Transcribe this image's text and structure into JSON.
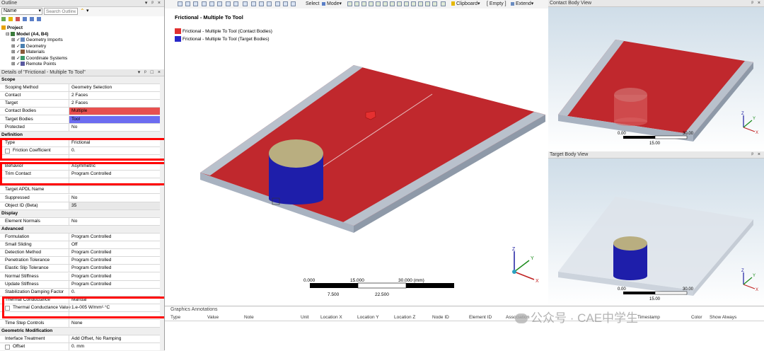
{
  "outline": {
    "title": "Outline",
    "filter_combo": "Name",
    "search_placeholder": "Search Outline",
    "tree": {
      "project": "Project",
      "model": "Model (A4, B4)",
      "items": [
        "Geometry Imports",
        "Geometry",
        "Materials",
        "Coordinate Systems",
        "Remote Points"
      ]
    }
  },
  "details": {
    "title": "Details of \"Frictional - Multiple To Tool\"",
    "rows": [
      {
        "type": "section",
        "label": "Scope"
      },
      {
        "label": "Scoping Method",
        "value": "Geometry Selection"
      },
      {
        "label": "Contact",
        "value": "2 Faces"
      },
      {
        "label": "Target",
        "value": "2 Faces"
      },
      {
        "label": "Contact Bodies",
        "value": "Multiple"
      },
      {
        "label": "Target Bodies",
        "value": "Tool"
      },
      {
        "label": "Protected",
        "value": "No"
      },
      {
        "type": "section",
        "label": "Definition"
      },
      {
        "label": "Type",
        "value": "Frictional"
      },
      {
        "label": "Friction Coefficient",
        "value": "0."
      },
      {
        "label": "",
        "value": ""
      },
      {
        "label": "Behavior",
        "value": "Asymmetric"
      },
      {
        "label": "Trim Contact",
        "value": "Program Controlled"
      },
      {
        "label": "",
        "value": ""
      },
      {
        "label": "Target APDL Name",
        "value": ""
      },
      {
        "label": "Suppressed",
        "value": "No"
      },
      {
        "label": "Object ID (Beta)",
        "value": "35"
      },
      {
        "type": "section",
        "label": "Display"
      },
      {
        "label": "Element Normals",
        "value": "No"
      },
      {
        "type": "section",
        "label": "Advanced"
      },
      {
        "label": "Formulation",
        "value": "Program Controlled"
      },
      {
        "label": "Small Sliding",
        "value": "Off"
      },
      {
        "label": "Detection Method",
        "value": "Program Controlled"
      },
      {
        "label": "Penetration Tolerance",
        "value": "Program Controlled"
      },
      {
        "label": "Elastic Slip Tolerance",
        "value": "Program Controlled"
      },
      {
        "label": "Normal Stiffness",
        "value": "Program Controlled"
      },
      {
        "label": "Update Stiffness",
        "value": "Program Controlled"
      },
      {
        "label": "Stabilization Damping Factor",
        "value": "0."
      },
      {
        "label": "Thermal Conductance",
        "value": "Manual"
      },
      {
        "label": "Thermal Conductance Value",
        "value": "1.e-005 W/mm²·°C"
      },
      {
        "label": "",
        "value": ""
      },
      {
        "label": "Time Step Controls",
        "value": "None"
      },
      {
        "type": "section",
        "label": "Geometric Modification"
      },
      {
        "label": "Interface Treatment",
        "value": "Add Offset, No Ramping"
      },
      {
        "label": "Offset",
        "value": "0. mm"
      }
    ]
  },
  "toolbar": {
    "select": "Select",
    "mode": "Mode",
    "clipboard": "Clipboard",
    "empty": "[ Empty ]",
    "extend": "Extend"
  },
  "graphics": {
    "title": "Frictional - Multiple To Tool",
    "legend": [
      {
        "label": "Frictional - Multiple To Tool (Contact Bodies)",
        "color": "#e03030"
      },
      {
        "label": "Frictional - Multiple To Tool (Target Bodies)",
        "color": "#2828c8"
      }
    ],
    "scale": {
      "top_labels": [
        "0.000",
        "15.000",
        "30.000 (mm)"
      ],
      "bottom_labels": [
        "7.500",
        "22.500"
      ]
    },
    "axes": {
      "x": "X",
      "y": "Y",
      "z": "Z"
    }
  },
  "contact_view": {
    "title": "Contact Body View",
    "scale": [
      "0.00",
      "30.00",
      "15.00"
    ]
  },
  "target_view": {
    "title": "Target Body View",
    "scale": [
      "0.00",
      "30.00",
      "15.00"
    ]
  },
  "annotations": {
    "title": "Graphics Annotations",
    "columns": [
      "Type",
      "Value",
      "Note",
      "Unit",
      "Location X",
      "Location Y",
      "Location Z",
      "Node ID",
      "Element ID",
      "Association",
      "Timestamp",
      "Color",
      "Show Always"
    ]
  },
  "watermark": "公众号 · CAE中学生",
  "colors": {
    "contact": "#c0282d",
    "target": "#1c1ca0",
    "selection_box": "#ff0000"
  }
}
